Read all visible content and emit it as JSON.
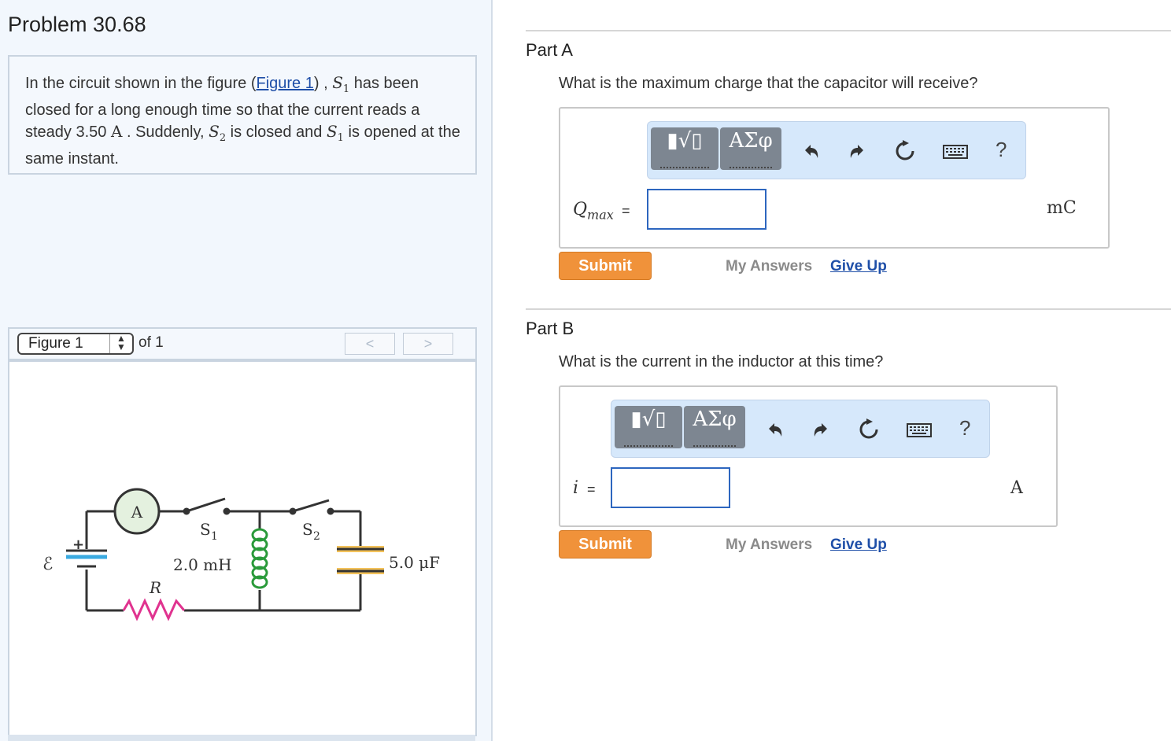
{
  "problem": {
    "title": "Problem 30.68",
    "text_before": "In the circuit shown in the figure (",
    "figure_link": "Figure 1",
    "text_after_link": ") , ",
    "s1": "S",
    "s1_sub": "1",
    "text_2": " has been closed for a long enough time so that the current reads a steady 3.50 ",
    "current_unit": "A",
    "text_3": " . Suddenly, ",
    "s2": "S",
    "s2_sub": "2",
    "text_4": " is closed and ",
    "s1b": "S",
    "s1b_sub": "1",
    "text_5": " is opened at the same instant."
  },
  "figure": {
    "selector_value": "Figure 1",
    "of_label": "of 1",
    "prev_icon": "<",
    "next_icon": ">",
    "circuit": {
      "ammeter": "A",
      "switch1": "S",
      "switch1_sub": "1",
      "switch2": "S",
      "switch2_sub": "2",
      "emf": "ℰ",
      "plus": "+",
      "inductor": "2.0 mH",
      "resistor": "R",
      "capacitor": "5.0 μF"
    }
  },
  "parts": [
    {
      "title": "Part A",
      "question": "What is the maximum charge that the capacitor will receive?",
      "toolbar": {
        "template_label": "▮√▯",
        "greek_label": "ΑΣφ",
        "help": "?"
      },
      "variable": "Q",
      "variable_sub": "max",
      "equals": "=",
      "input_value": "",
      "unit": "mC",
      "submit_label": "Submit",
      "my_answers_label": "My Answers",
      "give_up_label": "Give Up"
    },
    {
      "title": "Part B",
      "question": "What is the current in the inductor at this time?",
      "toolbar": {
        "template_label": "▮√▯",
        "greek_label": "ΑΣφ",
        "help": "?"
      },
      "variable": "i",
      "variable_sub": "",
      "equals": "=",
      "input_value": "",
      "unit": "A",
      "submit_label": "Submit",
      "my_answers_label": "My Answers",
      "give_up_label": "Give Up"
    }
  ],
  "colors": {
    "accent_orange": "#f0923a",
    "link_blue": "#1f4fa8",
    "toolbar_bg": "#d6e8fb",
    "panel_bg": "#f2f7fd"
  }
}
